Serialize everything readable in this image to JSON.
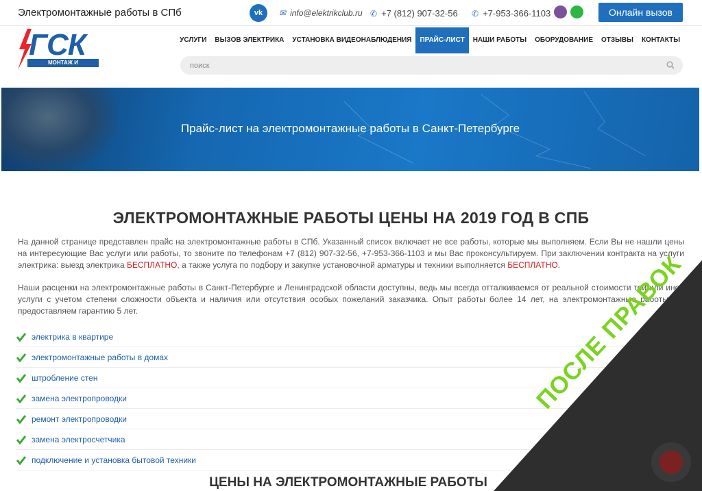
{
  "header": {
    "site_title": "Электромонтажные работы в СПб",
    "vk_label": "vk",
    "email": "info@elektrikclub.ru",
    "phone1": "+7 (812) 907-32-56",
    "phone2": "+7-953-366-1103",
    "call_button": "Онлайн вызов",
    "icons": [
      "vk-icon",
      "email-icon",
      "phone-icon",
      "viber-icon",
      "whatsapp-icon"
    ]
  },
  "logo": {
    "letters": "ГСК",
    "tagline": "МОНТАЖ И ОБСЛУЖИВАНИЕ"
  },
  "nav": {
    "items": [
      {
        "label": "УСЛУГИ",
        "active": false
      },
      {
        "label": "ВЫЗОВ ЭЛЕКТРИКА",
        "active": false
      },
      {
        "label": "УСТАНОВКА ВИДЕОНАБЛЮДЕНИЯ",
        "active": false
      },
      {
        "label": "ПРАЙС-ЛИСТ",
        "active": true
      },
      {
        "label": "НАШИ РАБОТЫ",
        "active": false
      },
      {
        "label": "ОБОРУДОВАНИЕ",
        "active": false
      },
      {
        "label": "ОТЗЫВЫ",
        "active": false
      },
      {
        "label": "КОНТАКТЫ",
        "active": false
      }
    ]
  },
  "search": {
    "placeholder": "поиск",
    "value": ""
  },
  "banner": {
    "title": "Прайс-лист на электромонтажные работы в Санкт-Петербурге"
  },
  "content": {
    "heading": "ЭЛЕКТРОМОНТАЖНЫЕ РАБОТЫ ЦЕНЫ НА 2019 ГОД В СПБ",
    "p1_a": "На данной странице представлен прайс на электромонтажные работы в СПб. Указанный список включает не все работы, которые мы выполняем. Если Вы не нашли цены на интересующие Вас услуги или работы, то звоните по телефонам +7 (812) 907-32-56, +7-953-366-1103 и мы Вас проконсультируем. При заключении контракта на услуги электрика: выезд электрика ",
    "p1_free1": "БЕСПЛАТНО",
    "p1_b": ", а также услуга по подбору и закупке установочной арматуры и техники выполняется ",
    "p1_free2": "БЕСПЛАТНО",
    "p1_c": ".",
    "p2": "Наши расценки на электромонтажные работы в Санкт-Петербурге и Ленинградской области доступны, ведь мы всегда отталкиваемся от реальной стоимости той или иной услуги с учетом степени сложности объекта и наличия или отсутствия особых пожеланий заказчика. Опыт работы более 14 лет, на электромонтажные работы мы предоставляем гарантию 5 лет.",
    "checklist": [
      "электрика в квартире",
      "электромонтажные работы в домах",
      "штробление стен",
      "замена электропроводки",
      "ремонт электропроводки",
      "замена электросчетчика",
      "подключение и установка бытовой техники"
    ],
    "subheading": "ЦЕНЫ НА ЭЛЕКТРОМОНТАЖНЫЕ РАБОТЫ"
  },
  "overlay": {
    "stamp": "ПОСЛЕ ПРАВОК"
  },
  "colors": {
    "brand_blue": "#1f6fbd",
    "link_blue": "#1f5fa8",
    "check_green": "#3aaa35",
    "free_red": "#d62020",
    "stamp_green": "#7bd321",
    "corner_dark": "#2e2e2e"
  }
}
